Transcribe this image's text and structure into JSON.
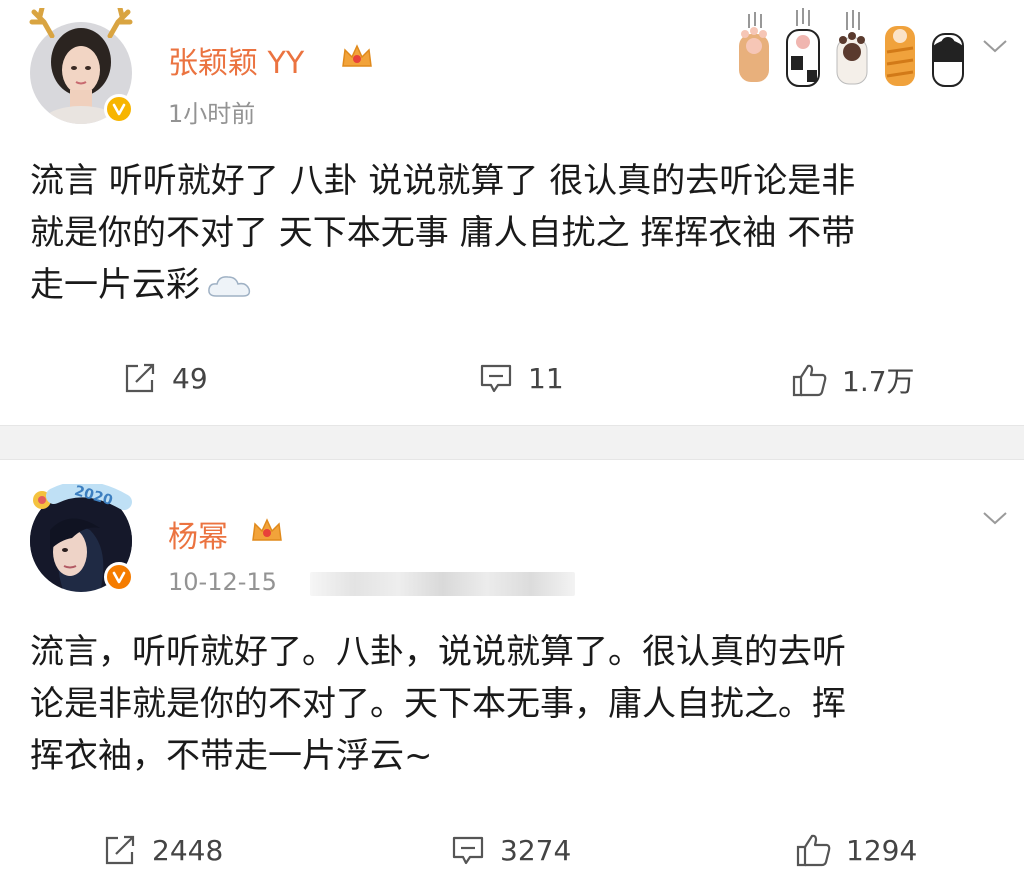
{
  "posts": [
    {
      "author": "张颖颖 YY",
      "time": "1小时前",
      "content_lines": [
        "流言 听听就好了 八卦 说说就算了 很认真的去听论是非",
        "就是你的不对了 天下本无事 庸人自扰之 挥挥衣袖 不带",
        "走一片云彩"
      ],
      "repost_count": "49",
      "comment_count": "11",
      "like_count": "1.7万"
    },
    {
      "author": "杨幂",
      "time": "10-12-15",
      "avatar_sticker_text": "2020",
      "content_lines": [
        "流言，听听就好了。八卦，说说就算了。很认真的去听",
        "论是非就是你的不对了。天下本无事，庸人自扰之。挥",
        "挥衣袖，不带走一片浮云~"
      ],
      "repost_count": "2448",
      "comment_count": "3274",
      "like_count": "1294"
    }
  ],
  "icons": {
    "repost": "share-icon",
    "comment": "comment-icon",
    "like": "thumbs-up-icon",
    "menu": "chevron-down-icon",
    "verified": "verified-badge-icon",
    "member": "crown-icon"
  },
  "colors": {
    "author_name": "#eb7340",
    "timestamp": "#939393",
    "verified_badge": "#f7b500",
    "divider": "#f2f2f2"
  }
}
